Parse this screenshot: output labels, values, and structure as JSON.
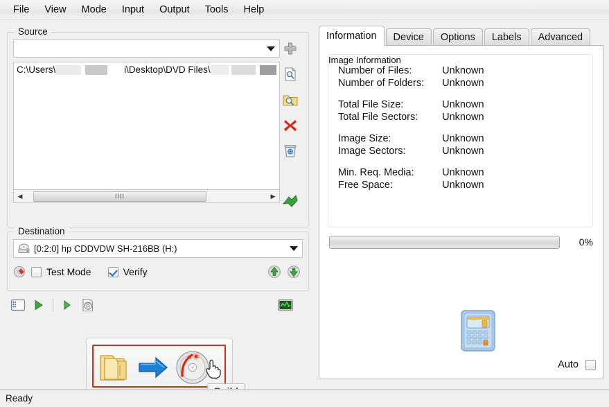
{
  "app": {
    "menu": [
      "File",
      "View",
      "Mode",
      "Input",
      "Output",
      "Tools",
      "Help"
    ],
    "status": "Ready"
  },
  "source": {
    "group_label": "Source",
    "combo_value": "",
    "combo_placeholder": "",
    "path_prefix": "C:\\Users\\",
    "path_middle": "i\\Desktop\\DVD Files\\",
    "icons": [
      {
        "name": "add-icon",
        "label": "Add"
      },
      {
        "name": "browse-file-icon",
        "label": "Browse for file"
      },
      {
        "name": "browse-folder-icon",
        "label": "Browse for folder"
      },
      {
        "name": "remove-icon",
        "label": "Remove"
      },
      {
        "name": "clear-list-icon",
        "label": "Clear list"
      },
      {
        "name": "import-icon",
        "label": "Import"
      }
    ],
    "scroll_grip": "IIII"
  },
  "destination": {
    "group_label": "Destination",
    "drive_value": "[0:2:0] hp CDDVDW SH-216BB (H:)",
    "test_mode_label": "Test Mode",
    "test_mode_checked": false,
    "verify_label": "Verify",
    "verify_checked": true,
    "eject_load_icons": [
      "eject-up-icon",
      "eject-down-icon"
    ]
  },
  "toolbar": {
    "buttons": [
      {
        "name": "queue-list-icon",
        "label": "Show queue"
      },
      {
        "name": "start-icon",
        "label": "Start"
      },
      {
        "name": "run-icon",
        "label": "Run"
      },
      {
        "name": "disc-info-icon",
        "label": "Disc info"
      }
    ],
    "right_button": {
      "name": "display-monitor-icon",
      "label": "Display"
    }
  },
  "build": {
    "tooltip": "Build",
    "folder_icon": "folders-icon",
    "arrow_icon": "arrow-right-icon",
    "disc_icon": "burn-disc-icon",
    "cursor_icon": "hand-cursor-icon",
    "highlight_color": "#e02a12"
  },
  "right_panel": {
    "tabs": [
      {
        "label": "Information",
        "active": true
      },
      {
        "label": "Device",
        "active": false
      },
      {
        "label": "Options",
        "active": false
      },
      {
        "label": "Labels",
        "active": false
      },
      {
        "label": "Advanced",
        "active": false
      }
    ],
    "info_group_label": "Image Information",
    "info_rows": [
      {
        "key": "Number of Files:",
        "value": "Unknown"
      },
      {
        "key": "Number of Folders:",
        "value": "Unknown"
      },
      {
        "gap": true
      },
      {
        "key": "Total File Size:",
        "value": "Unknown"
      },
      {
        "key": "Total File Sectors:",
        "value": "Unknown"
      },
      {
        "gap": true
      },
      {
        "key": "Image Size:",
        "value": "Unknown"
      },
      {
        "key": "Image Sectors:",
        "value": "Unknown"
      },
      {
        "gap": true
      },
      {
        "key": "Min. Req. Media:",
        "value": "Unknown"
      },
      {
        "key": "Free Space:",
        "value": "Unknown"
      }
    ],
    "progress": {
      "percent_label": "0%",
      "percent_value": 0
    },
    "calculator_icon": "calculator-icon",
    "auto_label": "Auto",
    "auto_checked": false
  }
}
